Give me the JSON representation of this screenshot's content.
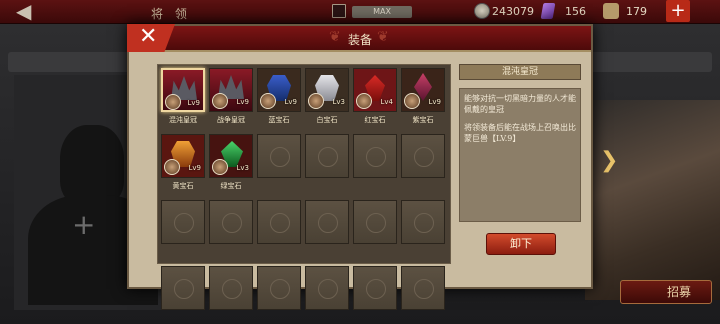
{
  "topbar": {
    "title": "将 领",
    "max_label": "MAX",
    "coins": "243079",
    "gems": "156",
    "grain": "179",
    "plus_label": "+",
    "back_label": "◀"
  },
  "background": {
    "plus_label": "+",
    "recruit_label": "招募"
  },
  "modal": {
    "title": "装备",
    "close_label": "✕",
    "laurel": "❦",
    "items": [
      {
        "name": "混沌皇冠",
        "level": "Lv9",
        "art": "crown",
        "selected": true
      },
      {
        "name": "战争皇冠",
        "level": "Lv9",
        "art": "crown",
        "selected": false
      },
      {
        "name": "蓝宝石",
        "level": "Lv9",
        "art": "blue",
        "selected": false
      },
      {
        "name": "白宝石",
        "level": "Lv3",
        "art": "white",
        "selected": false
      },
      {
        "name": "红宝石",
        "level": "Lv4",
        "art": "red",
        "selected": false
      },
      {
        "name": "紫宝石",
        "level": "Lv9",
        "art": "purple",
        "selected": false
      },
      {
        "name": "黄宝石",
        "level": "Lv9",
        "art": "yellow",
        "selected": false
      },
      {
        "name": "绿宝石",
        "level": "Lv3",
        "art": "green",
        "selected": false
      }
    ],
    "empty_slots": 16,
    "detail": {
      "title": "混沌皇冠",
      "desc": "能够对抗一切黑暗力量的人才能佩戴的皇冠",
      "bonus": "将领装备后能在战场上召唤出比蒙巨兽【LV.9】"
    },
    "unequip_label": "卸下"
  },
  "colors": {
    "topbar": "#4a0e0e",
    "modal_bg": "#c9bba0",
    "button_red": "#c63a22"
  }
}
